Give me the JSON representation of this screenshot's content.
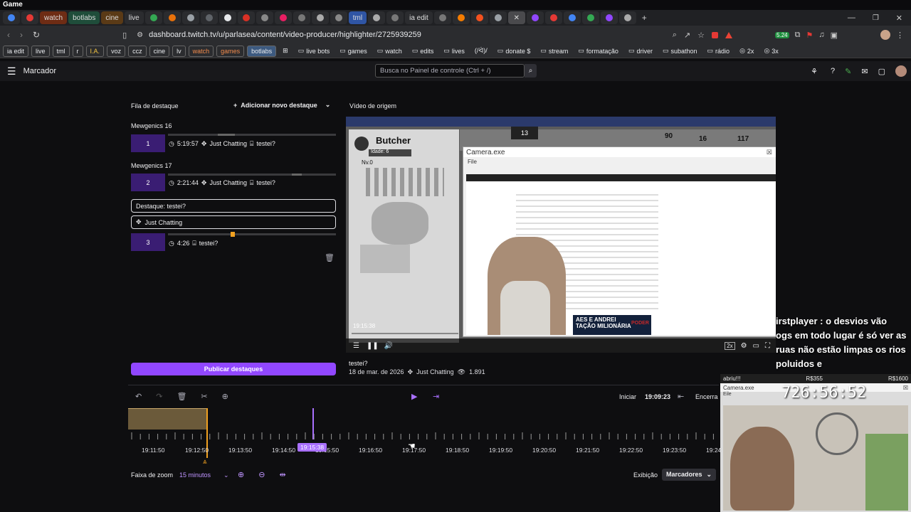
{
  "os": {
    "title": "Game"
  },
  "tabs": [
    {
      "label": "watch",
      "color": "#c8532a"
    },
    {
      "label": "botlabs",
      "color": "#2d6a4f"
    },
    {
      "label": "cine",
      "color": "#7a4a1a"
    },
    {
      "label": "live",
      "color": "#3b3b3b"
    },
    {
      "label": "tml",
      "color": "#2f55a4"
    },
    {
      "label": "ia edit",
      "color": "#3b3b3b"
    }
  ],
  "address": {
    "url": "dashboard.twitch.tv/u/parlasea/content/video-producer/highlighter/2725939259",
    "ext_badge": "5.24"
  },
  "bookmarks": {
    "pills": [
      "ia edit",
      "live",
      "tml",
      "r",
      "I.A.",
      "voz",
      "ccz",
      "cine",
      "lv",
      "watch",
      "games",
      "botlabs"
    ],
    "folders": [
      "live bots",
      "games",
      "watch",
      "edits",
      "lives",
      "(/ᐛ)/",
      "donate $",
      "stream",
      "formatação",
      "driver",
      "subathon",
      "rádio",
      "2x",
      "3x"
    ]
  },
  "header": {
    "title": "Marcador",
    "search_placeholder": "Busca no Painel de controle (Ctrl + /)"
  },
  "queue": {
    "title": "Fila de destaque",
    "add_label": "Adicionar novo destaque",
    "items": [
      {
        "group": "Mewgenics 16",
        "num": "1",
        "duration": "5:19:57",
        "category": "Just Chatting",
        "title": "testei?"
      },
      {
        "group": "Mewgenics 17",
        "num": "2",
        "duration": "2:21:44",
        "category": "Just Chatting",
        "title": "testei?"
      }
    ],
    "edit_title_value": "Destaque: testei?",
    "edit_category_value": "Just Chatting",
    "third": {
      "num": "3",
      "duration": "4:26",
      "title": "testei?"
    },
    "publish_label": "Publicar destaques"
  },
  "source": {
    "title": "Vídeo de origem",
    "timestamp": "19:15:38",
    "speed": "2x",
    "video_title": "testei?",
    "date": "18 de mar. de 2026",
    "category": "Just Chatting",
    "views": "1.891",
    "camera_window_title": "Camera.exe",
    "camera_menu": "File",
    "game_labels": {
      "butcher": "Butcher",
      "age": "Idade: 6",
      "nv": "Nv.0",
      "coins": "13",
      "stat1": "90",
      "stat2": "16",
      "stat3": "117"
    },
    "news_footer": "AES E ANDREI\nTAÇÃO MILIONÁRIA",
    "news_brand": "PODER",
    "chat_overlay": "irstplayer : o desvios vão\nogs em todo lugar é só ver as\nruas não estão limpas os rios poluidos e\npor ai vai ..."
  },
  "timeline": {
    "start_label": "Iniciar",
    "start_time": "19:09:23",
    "end_label": "Encerra",
    "playhead": "19:15:38",
    "ticks": [
      "19:11:50",
      "19:12:50",
      "19:13:50",
      "19:14:50",
      "19:15:50",
      "19:16:50",
      "19:17:50",
      "19:18:50",
      "19:19:50",
      "19:20:50",
      "19:21:50",
      "19:22:50",
      "19:23:50",
      "19:24"
    ],
    "zoom_label": "Faixa de zoom",
    "zoom_value": "15 minutos",
    "view_label": "Exibição",
    "markers_label": "Marcadores"
  },
  "webcam": {
    "top_left": "abriu!!!",
    "top_mid": "R$355",
    "top_right": "R$1600",
    "window_title": "Camera.exe",
    "menu": "Eile",
    "counter": "726:56:52"
  },
  "colors": {
    "accent": "#9147ff",
    "segment": "#6b5a3a",
    "playhead": "#a970ff"
  }
}
